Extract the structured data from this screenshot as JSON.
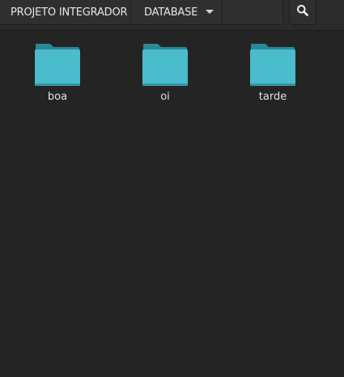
{
  "breadcrumbs": [
    {
      "label": "PROJETO INTEGRADOR"
    },
    {
      "label": "DATABASE"
    }
  ],
  "search": {
    "icon": "search-icon"
  },
  "folders": [
    {
      "name": "boa",
      "icon": "folder-icon"
    },
    {
      "name": "oi",
      "icon": "folder-icon"
    },
    {
      "name": "tarde",
      "icon": "folder-icon"
    }
  ],
  "colors": {
    "folder": "#4abccb",
    "folder_dark": "#2a8996",
    "background": "#242424"
  }
}
